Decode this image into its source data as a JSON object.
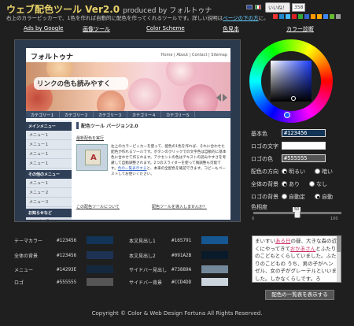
{
  "header": {
    "title": "ウェブ配色ツール Ver2.0",
    "by": "produced by フォルトゥナ",
    "subtitle_prefix": "右上のカラーピッカーで、1色を作れば自動的に配色を作ってくれるツールです。詳しい説明は",
    "subtitle_link": "ページの下の方",
    "subtitle_suffix": "に。",
    "like_label": "いいね！",
    "like_count": "358"
  },
  "nav": {
    "items": [
      "Ads by Google",
      "画像ツール",
      "Color Scheme",
      "色見本",
      "カラー診断"
    ]
  },
  "preview": {
    "logo": "フォルトゥナ",
    "site_nav": "Home | About | Contact | Sitemap",
    "hero_caption": "リンクの色も読みやすく",
    "tabs": [
      "カテゴリー１",
      "カテゴリー２",
      "カテゴリー３",
      "カテゴリー４",
      "カテゴリー５"
    ],
    "side_head_1": "メインメニュー",
    "side_items_1": [
      "メニュー１",
      "メニュー１",
      "メニュー１",
      "メニュー１"
    ],
    "side_head_2": "その他のメニュー",
    "side_items_2": [
      "メニュー１",
      "メニュー２",
      "メニュー３"
    ],
    "side_head_3": "お知らせなど",
    "side_foot": "2010年2月27日",
    "main_title": "配色ツール バージョン2.0",
    "main_sub": "最新配色を実行",
    "body_1": "左上のカラーピッカーを使って、配色の1色を作れば、それに合わせた配色が作れるツールです。ボタンのクリックでの文字色は自動的に基本色に合わせて作られます。",
    "body_2": "アクセントの色はテキストの読みやすさを考慮して自動調整されます。2つのスライダーを使って微調整も可能です。",
    "body_link": "色の一覧表示する",
    "body_3": "と、本来の全配色を確認できます。コピーもペーストしてお使いください。",
    "about_link": "この配色ツールについて",
    "install_link": "配色ツールを導入しませんか？"
  },
  "controls": {
    "base_label": "基本色",
    "base_value": "#123456",
    "logo_text_label": "ロゴの文字",
    "logo_text_value": "",
    "logo_color_label": "ロゴの色",
    "logo_color_value": "#555555",
    "direction_label": "配色の方向",
    "direction_opts": [
      "明るい",
      "暗い"
    ],
    "bg_label": "全体の背景",
    "bg_opts": [
      "あり",
      "なし"
    ],
    "logo_bg_label": "ロゴの背景",
    "logo_bg_opts": [
      "自動定",
      "自動"
    ],
    "saturation_label": "色相度",
    "slider_min": "0",
    "slider_max": "100",
    "slider_value": 50,
    "slider_value_label": "50"
  },
  "palette": {
    "left": [
      {
        "name": "テーマカラー",
        "hex": "#123456",
        "swatch": "#123456"
      },
      {
        "name": "全体の背景",
        "hex": "#123456",
        "swatch": "#1e3354"
      },
      {
        "name": "メニュー",
        "hex": "#14293E",
        "swatch": "#14293e"
      },
      {
        "name": "ロゴ",
        "hex": "#555555",
        "swatch": "#555555"
      }
    ],
    "right": [
      {
        "name": "本文見出し1",
        "hex": "#165791",
        "swatch": "#165791"
      },
      {
        "name": "本文見出し2",
        "hex": "#091A2B",
        "swatch": "#091a2b"
      },
      {
        "name": "サイドバー見出し",
        "hex": "#73889A",
        "swatch": "#73889a"
      },
      {
        "name": "サイドバー背景",
        "hex": "#CCD4DD",
        "swatch": "#ccd4dd"
      }
    ]
  },
  "textbox": {
    "t1": "まいすい",
    "l1": "ある日",
    "t2": "の昼、大きな森の近くにやってきて",
    "l2": "おかあさん",
    "t3": "とふたりのこどもとくらしていました。ふたりのこどもの うち、男の子がヘンゼル、女の子がグレーテルといいました。しかなくらしです。ろ"
  },
  "list_button": "配色の一覧表を表示する",
  "footer": "Copyright © Color & Web Design Fortuna All Rights Reserved.",
  "colors": {
    "accent": "#e8d26a",
    "link": "#66ccff"
  }
}
